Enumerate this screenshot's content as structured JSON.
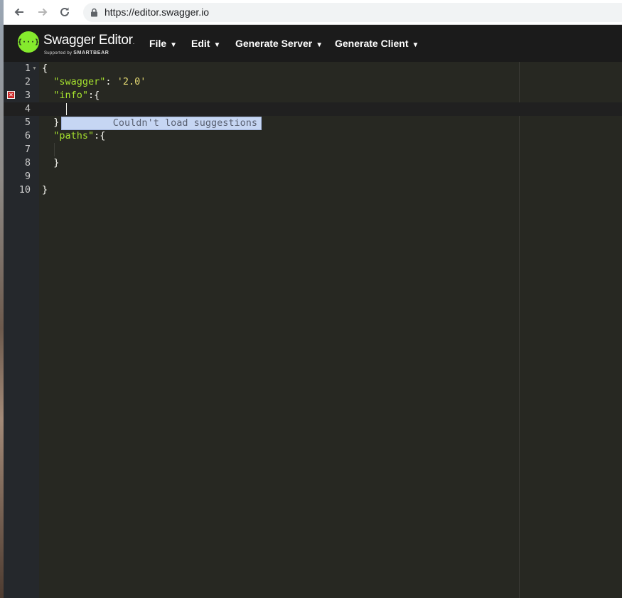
{
  "browser": {
    "url": "https://editor.swagger.io",
    "back_icon": "arrow-left-icon",
    "forward_icon": "arrow-right-icon",
    "reload_icon": "reload-icon",
    "lock_icon": "lock-icon"
  },
  "app": {
    "title": "Swagger Editor",
    "title_suffix": ".",
    "subtitle_prefix": "Supported by",
    "subtitle_brand": "SMARTBEAR",
    "logo_glyph": "{···}",
    "brand_color": "#85ea2d"
  },
  "menu": {
    "file": "File",
    "edit": "Edit",
    "generate_server": "Generate Server",
    "generate_client": "Generate Client",
    "caret": "▼"
  },
  "editor": {
    "line_numbers": [
      "1",
      "2",
      "3",
      "4",
      "5",
      "6",
      "7",
      "8",
      "9",
      "10"
    ],
    "error_line": "3",
    "lines": [
      {
        "plain": "{"
      },
      {
        "indent": "  ",
        "key": "\"swagger\"",
        "sep": ": ",
        "value": "'2.0'"
      },
      {
        "indent": "  ",
        "key": "\"info\"",
        "rest": ":{"
      },
      {
        "plain": ""
      },
      {
        "indent": "  ",
        "close": "}"
      },
      {
        "indent": "  ",
        "key": "\"paths\"",
        "rest": ":{"
      },
      {
        "plain": ""
      },
      {
        "indent": "  ",
        "close": "}"
      },
      {
        "plain": ""
      },
      {
        "plain": "}"
      }
    ],
    "suggestion_message": "Couldn't load suggestions"
  }
}
